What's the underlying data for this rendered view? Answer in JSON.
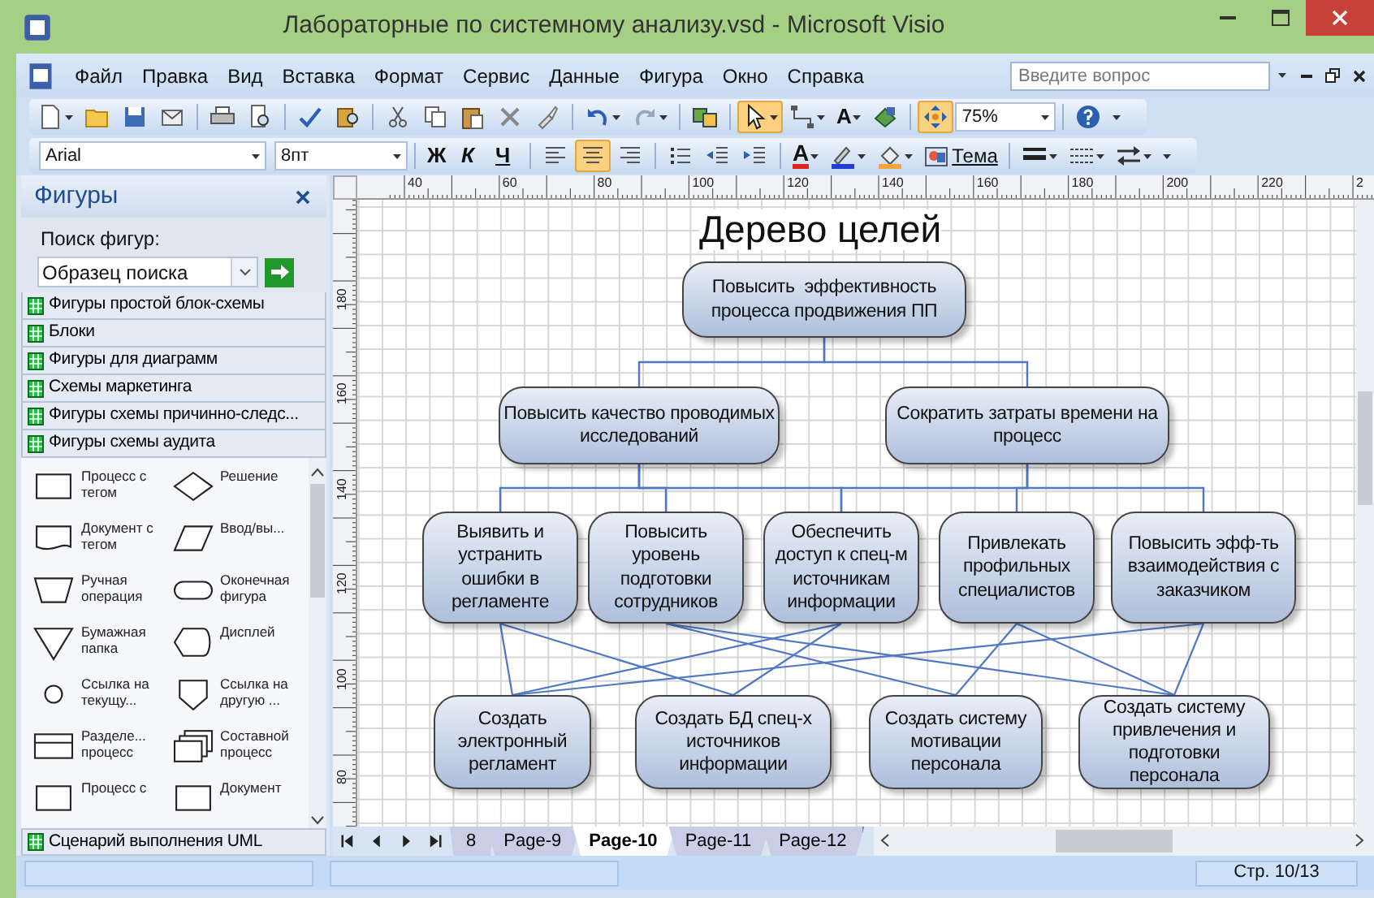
{
  "window": {
    "title": "Лабораторные по системному анализу.vsd - Microsoft Visio"
  },
  "menu": [
    {
      "label": "Файл"
    },
    {
      "label": "Правка"
    },
    {
      "label": "Вид"
    },
    {
      "label": "Вставка"
    },
    {
      "label": "Формат"
    },
    {
      "label": "Сервис"
    },
    {
      "label": "Данные"
    },
    {
      "label": "Фигура"
    },
    {
      "label": "Окно"
    },
    {
      "label": "Справка"
    }
  ],
  "help_search": {
    "placeholder": "Введите вопрос"
  },
  "toolbar_standard": [
    {
      "kind": "new",
      "selected": false,
      "dropdown": true
    },
    {
      "kind": "open",
      "selected": false
    },
    {
      "kind": "save",
      "selected": false
    },
    {
      "kind": "permission",
      "selected": false
    },
    {
      "kind": "print",
      "selected": false,
      "group_start": true
    },
    {
      "kind": "preview",
      "selected": false
    },
    {
      "kind": "spelling",
      "selected": false,
      "group_start": true
    },
    {
      "kind": "research",
      "selected": false
    },
    {
      "kind": "cut",
      "selected": false,
      "group_start": true
    },
    {
      "kind": "copy",
      "selected": false
    },
    {
      "kind": "paste",
      "selected": false
    },
    {
      "kind": "delete",
      "selected": false
    },
    {
      "kind": "format-painter",
      "selected": false
    },
    {
      "kind": "undo",
      "selected": false,
      "dropdown": true,
      "group_start": true
    },
    {
      "kind": "redo",
      "selected": false,
      "dropdown": true
    },
    {
      "kind": "shapes",
      "selected": false,
      "group_start": true
    },
    {
      "kind": "pointer",
      "selected": true,
      "dropdown": true,
      "group_start": true
    },
    {
      "kind": "connector",
      "selected": false,
      "dropdown": true
    },
    {
      "kind": "text",
      "label": "A",
      "selected": false,
      "dropdown": true
    },
    {
      "kind": "fill-tool",
      "selected": false
    },
    {
      "kind": "pan-zoom",
      "selected": true,
      "group_start": true
    }
  ],
  "zoom": {
    "value": "75%"
  },
  "toolbar_formatting": {
    "font": "Arial",
    "size": "8пт",
    "buttons": [
      {
        "kind": "bold",
        "label": "Ж",
        "selected": false,
        "group_start": true
      },
      {
        "kind": "italic",
        "label": "К",
        "selected": false
      },
      {
        "kind": "underline",
        "label": "Ч",
        "selected": false
      },
      {
        "kind": "align-left",
        "selected": false,
        "group_start": true
      },
      {
        "kind": "align-center",
        "selected": true
      },
      {
        "kind": "align-right",
        "selected": false
      },
      {
        "kind": "bullets",
        "selected": false,
        "group_start": true
      },
      {
        "kind": "outdent",
        "selected": false
      },
      {
        "kind": "indent",
        "selected": false
      },
      {
        "kind": "font-color",
        "label": "A",
        "selected": false,
        "dropdown": true,
        "group_start": true
      },
      {
        "kind": "line-color",
        "selected": false,
        "dropdown": true
      },
      {
        "kind": "fill-color",
        "selected": false,
        "dropdown": true
      },
      {
        "kind": "theme",
        "label": "Тема",
        "selected": false
      },
      {
        "kind": "line-weight",
        "selected": false,
        "dropdown": true,
        "group_start": true
      },
      {
        "kind": "line-pattern",
        "selected": false,
        "dropdown": true
      },
      {
        "kind": "line-ends",
        "selected": false,
        "dropdown": true
      }
    ]
  },
  "sidebar": {
    "title": "Фигуры",
    "search_label": "Поиск фигур:",
    "search_value": "Образец поиска",
    "stencils": [
      {
        "label": "Фигуры простой блок-схемы"
      },
      {
        "label": "Блоки"
      },
      {
        "label": "Фигуры для диаграмм"
      },
      {
        "label": "Схемы маркетинга"
      },
      {
        "label": "Фигуры схемы причинно-следс..."
      },
      {
        "label": "Фигуры схемы аудита"
      }
    ],
    "shapes": [
      {
        "kind": "rect",
        "label": "Процесс с тегом"
      },
      {
        "kind": "diamond",
        "label": "Решение"
      },
      {
        "kind": "document",
        "label": "Документ с тегом"
      },
      {
        "kind": "parallelogram",
        "label": "Ввод/вы..."
      },
      {
        "kind": "trapezoid",
        "label": "Ручная операция"
      },
      {
        "kind": "terminator",
        "label": "Оконечная фигура"
      },
      {
        "kind": "triangle",
        "label": "Бумажная папка"
      },
      {
        "kind": "display",
        "label": "Дисплей"
      },
      {
        "kind": "circle",
        "label": "Ссылка на текущу..."
      },
      {
        "kind": "offpage",
        "label": "Ссылка на другую ..."
      },
      {
        "kind": "divided",
        "label": "Разделе... процесс"
      },
      {
        "kind": "stack",
        "label": "Составной процесс"
      },
      {
        "kind": "rect",
        "label": "Процесс с"
      },
      {
        "kind": "rect",
        "label": "Документ"
      }
    ],
    "footer_stencil": {
      "label": "Сценарий выполнения UML"
    }
  },
  "rulers": {
    "horizontal": [
      "40",
      "60",
      "80",
      "100",
      "120",
      "140",
      "160",
      "180",
      "200",
      "220",
      "2"
    ],
    "vertical": [
      "180",
      "160",
      "140",
      "120",
      "100",
      "80"
    ]
  },
  "diagram": {
    "title": "Дерево целей",
    "tiers": [
      {
        "goals": [
          {
            "text": "Повысить  эффективность процесса продвижения ПП"
          }
        ]
      },
      {
        "goals": [
          {
            "text": "Повысить качество проводимых исследований"
          },
          {
            "text": "Сократить затраты времени на процесс"
          }
        ]
      },
      {
        "goals": [
          {
            "text": "Выявить и устранить ошибки в регламенте"
          },
          {
            "text": "Повысить уровень подготовки сотрудников"
          },
          {
            "text": "Обеспечить доступ к спец-м источникам информации"
          },
          {
            "text": "Привлекать профильных специалистов"
          },
          {
            "text": "Повысить эфф-ть взаимодействия с заказчиком"
          }
        ]
      },
      {
        "goals": [
          {
            "text": "Создать электронный регламент"
          },
          {
            "text": "Создать БД спец-х источников информации"
          },
          {
            "text": "Создать систему мотивации персонала"
          },
          {
            "text": "Создать систему привлечения и подготовки персонала"
          }
        ]
      }
    ]
  },
  "page_tabs": [
    {
      "label": "8",
      "selected": false
    },
    {
      "label": "Page-9",
      "selected": false
    },
    {
      "label": "Page-10",
      "selected": true
    },
    {
      "label": "Page-11",
      "selected": false
    },
    {
      "label": "Page-12",
      "selected": false
    }
  ],
  "status_bar": {
    "page": "Стр. 10/13"
  }
}
